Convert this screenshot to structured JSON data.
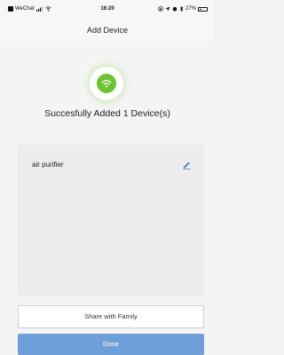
{
  "status_bar": {
    "carrier": "WeChat",
    "time": "16:20",
    "battery_text": "27%"
  },
  "header": {
    "title": "Add Device"
  },
  "success": {
    "icon": "wifi-icon",
    "icon_color": "#6cc331",
    "message": "Succesfully Added 1 Device(s)"
  },
  "devices": [
    {
      "name": "air purifier",
      "action_icon": "pencil-icon"
    }
  ],
  "buttons": {
    "share_label": "Share with Family",
    "done_label": "Done",
    "done_color": "#6f9fd8"
  }
}
